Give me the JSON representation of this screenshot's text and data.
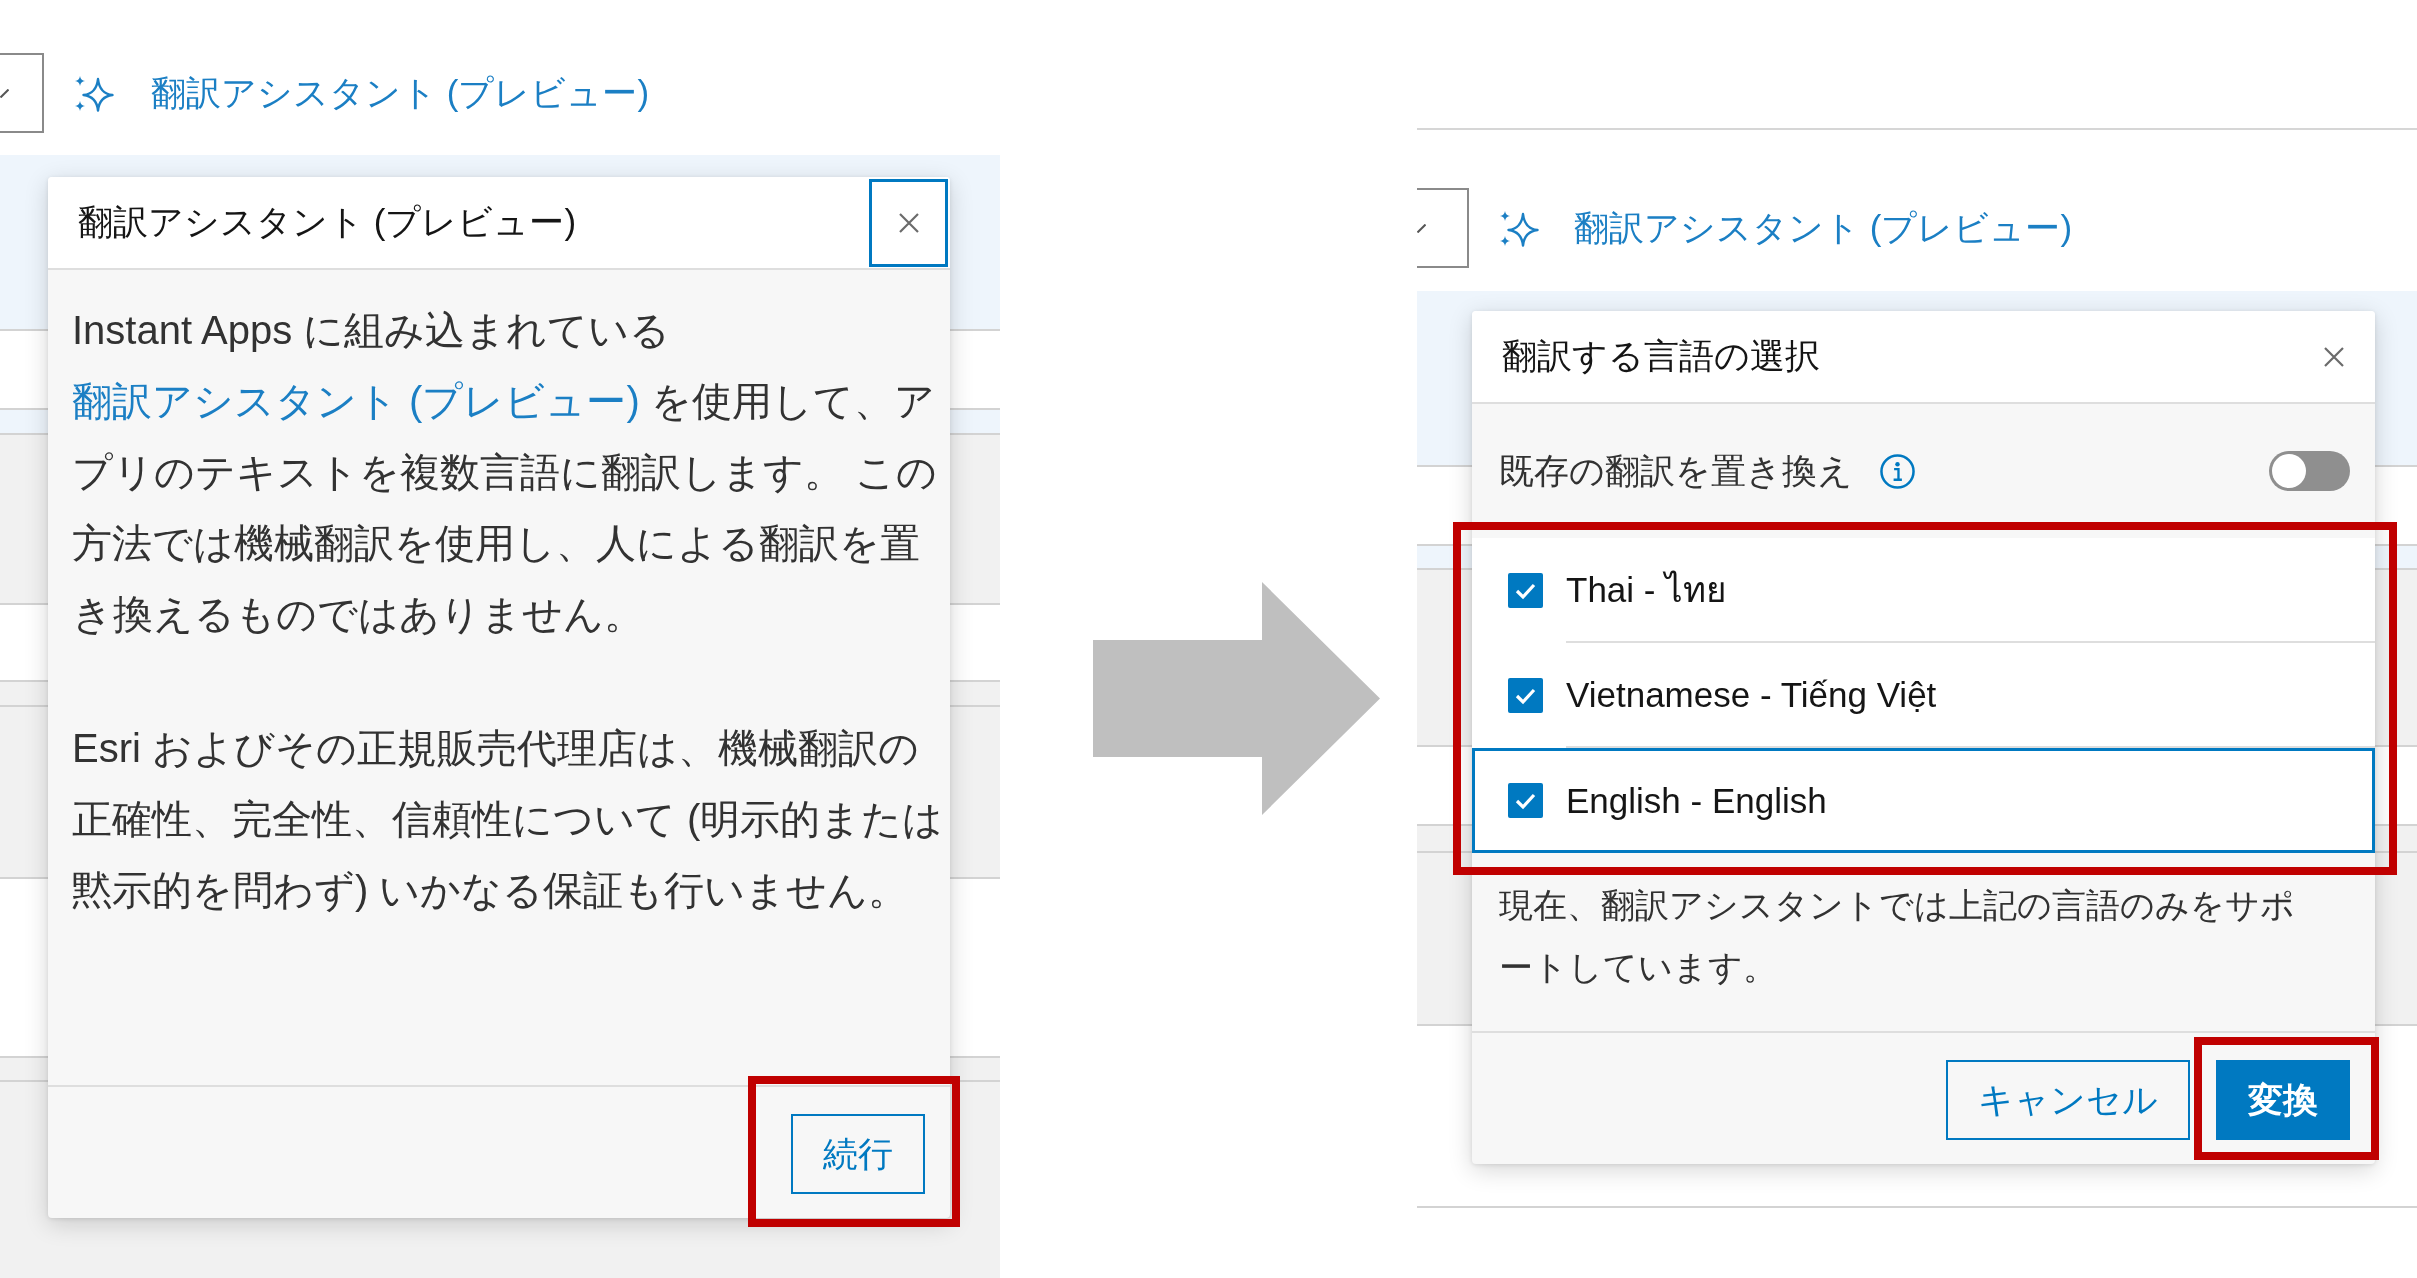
{
  "screenshots": [
    {
      "toolbar": {
        "link": "翻訳アシスタント (プレビュー)"
      },
      "dialog": {
        "title": "翻訳アシスタント (プレビュー)",
        "close_button": {
          "focused": true
        },
        "paragraphs": [
          {
            "parts": [
              {
                "kind": "text",
                "text": "Instant Apps に組み込まれている"
              },
              {
                "kind": "link",
                "text": "翻訳アシスタント (プレビュー)"
              },
              {
                "kind": "text",
                "text": " を使用して、アプリのテキストを複数言語に翻訳します。 この方法では機械翻訳を使用し、人による翻訳を置き換えるものではありません。"
              }
            ]
          },
          {
            "parts": [
              {
                "kind": "text",
                "text": "Esri およびその正規販売代理店は、機械翻訳の正確性、完全性、信頼性について (明示的または黙示的を問わず) いかなる保証も行いません。"
              }
            ]
          }
        ],
        "buttons": [
          {
            "label": "続行",
            "kind": "outline",
            "highlighted": true
          }
        ]
      }
    },
    {
      "toolbar": {
        "link": "翻訳アシスタント (プレビュー)"
      },
      "dialog": {
        "title": "翻訳する言語の選択",
        "close_button": {
          "focused": false
        },
        "replace_toggle": {
          "label": "既存の翻訳を置き換え",
          "on": false
        },
        "languages": {
          "highlighted": true,
          "items": [
            {
              "label": "Thai - ไทย",
              "checked": true,
              "focused": false
            },
            {
              "label": "Vietnamese - Tiếng Việt",
              "checked": true,
              "focused": false
            },
            {
              "label": "English - English",
              "checked": true,
              "focused": true
            }
          ]
        },
        "note": "現在、翻訳アシスタントでは上記の言語のみをサポートしています。",
        "buttons": [
          {
            "label": "キャンセル",
            "kind": "outline",
            "highlighted": false
          },
          {
            "label": "変換",
            "kind": "primary",
            "highlighted": true
          }
        ]
      }
    }
  ]
}
